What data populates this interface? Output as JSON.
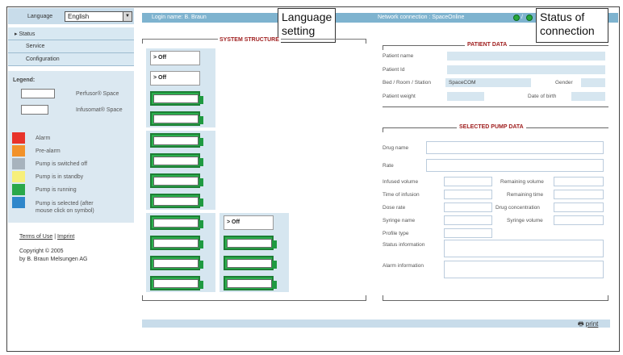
{
  "language": {
    "label": "Language",
    "selected": "English"
  },
  "header": {
    "login": "Login name: B. Braun",
    "network": "Network connection : SpaceOnline"
  },
  "callouts": {
    "language": [
      "Language",
      "setting"
    ],
    "status": [
      "Status of",
      "connection"
    ]
  },
  "nav": [
    {
      "label": "Status",
      "active": true
    },
    {
      "label": "Service"
    },
    {
      "label": "Configuration"
    }
  ],
  "legend": {
    "title": "Legend:",
    "devices": [
      "Perfusor® Space",
      "Infusomat® Space"
    ],
    "colors": [
      {
        "color": "#e8332a",
        "label": "Alarm"
      },
      {
        "color": "#f2922a",
        "label": "Pre-alarm"
      },
      {
        "color": "#a7b3bd",
        "label": "Pump is switched off"
      },
      {
        "color": "#f7ef7a",
        "label": "Pump is in standby"
      },
      {
        "color": "#2aa84a",
        "label": "Pump is running"
      },
      {
        "color": "#2f87cb",
        "label": "Pump is selected (after mouse click on symbol)"
      }
    ]
  },
  "footer": {
    "terms": "Terms of Use",
    "sep": "|",
    "imprint": "Imprint",
    "copyright1": "Copyright © 2005",
    "copyright2": "by B. Braun Melsungen AG"
  },
  "system": {
    "title": "SYSTEM STRUCTURE",
    "off_label": "> Off"
  },
  "patient": {
    "title": "PATIENT DATA",
    "name_label": "Patient name",
    "id_label": "Patient Id",
    "bed_label": "Bed / Room / Station",
    "bed_value": "SpaceCOM",
    "gender_label": "Gender",
    "weight_label": "Patient weight",
    "dob_label": "Date of birth"
  },
  "pump": {
    "title": "SELECTED PUMP DATA",
    "drug_name": "Drug name",
    "rate": "Rate",
    "infused_volume": "Infused volume",
    "remaining_volume": "Remaining volume",
    "time_of_infusion": "Time of infusion",
    "remaining_time": "Remaining time",
    "dose_rate": "Dose rate",
    "drug_concentration": "Drug concentration",
    "syringe_name": "Syringe name",
    "syringe_volume": "Syringe volume",
    "profile_type": "Profile type",
    "status_information": "Status information",
    "alarm_information": "Alarm information"
  },
  "print_label": "print"
}
